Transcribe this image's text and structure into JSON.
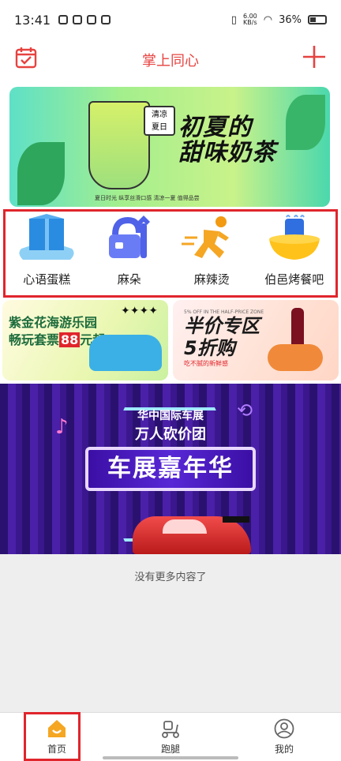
{
  "status_bar": {
    "time": "13:41",
    "speed_value": "6.00",
    "speed_unit": "KB/s",
    "battery": "36%"
  },
  "header": {
    "title": "掌上同心",
    "calendar_icon": "calendar-check-icon",
    "add_icon": "plus-icon"
  },
  "banner_top": {
    "tag_line1": "清凉",
    "tag_line2": "夏日",
    "headline_line1": "初夏的",
    "headline_line2": "甜味奶茶",
    "fine_print": "夏日时光 纵享丝滑口感 清凉一夏 值得品尝"
  },
  "categories": [
    {
      "label": "心语蛋糕",
      "icon": "gift-box-icon"
    },
    {
      "label": "麻朵",
      "icon": "repair-tools-icon"
    },
    {
      "label": "麻辣烫",
      "icon": "running-man-icon"
    },
    {
      "label": "伯邑烤餐吧",
      "icon": "hotpot-bowl-icon"
    }
  ],
  "promo_left": {
    "line1": "紫金花海游乐园",
    "line2_prefix": "畅玩套票",
    "price": "88",
    "line2_suffix": "元起"
  },
  "promo_right": {
    "small": "5% OFF IN THE HALF-PRICE ZONE",
    "line1": "半价专区",
    "line2": "5折购",
    "sub": "吃不腻的新鲜感"
  },
  "banner_bottom": {
    "line1": "华中国际车展",
    "line2": "万人砍价团",
    "main": "车展嘉年华"
  },
  "footer_text": "没有更多内容了",
  "tabs": [
    {
      "label": "首页",
      "icon": "home-icon",
      "active": true
    },
    {
      "label": "跑腿",
      "icon": "scooter-icon",
      "active": false
    },
    {
      "label": "我的",
      "icon": "user-icon",
      "active": false
    }
  ],
  "colors": {
    "accent": "#e64340",
    "highlight_box": "#e0252c",
    "home_icon": "#f5a623"
  }
}
